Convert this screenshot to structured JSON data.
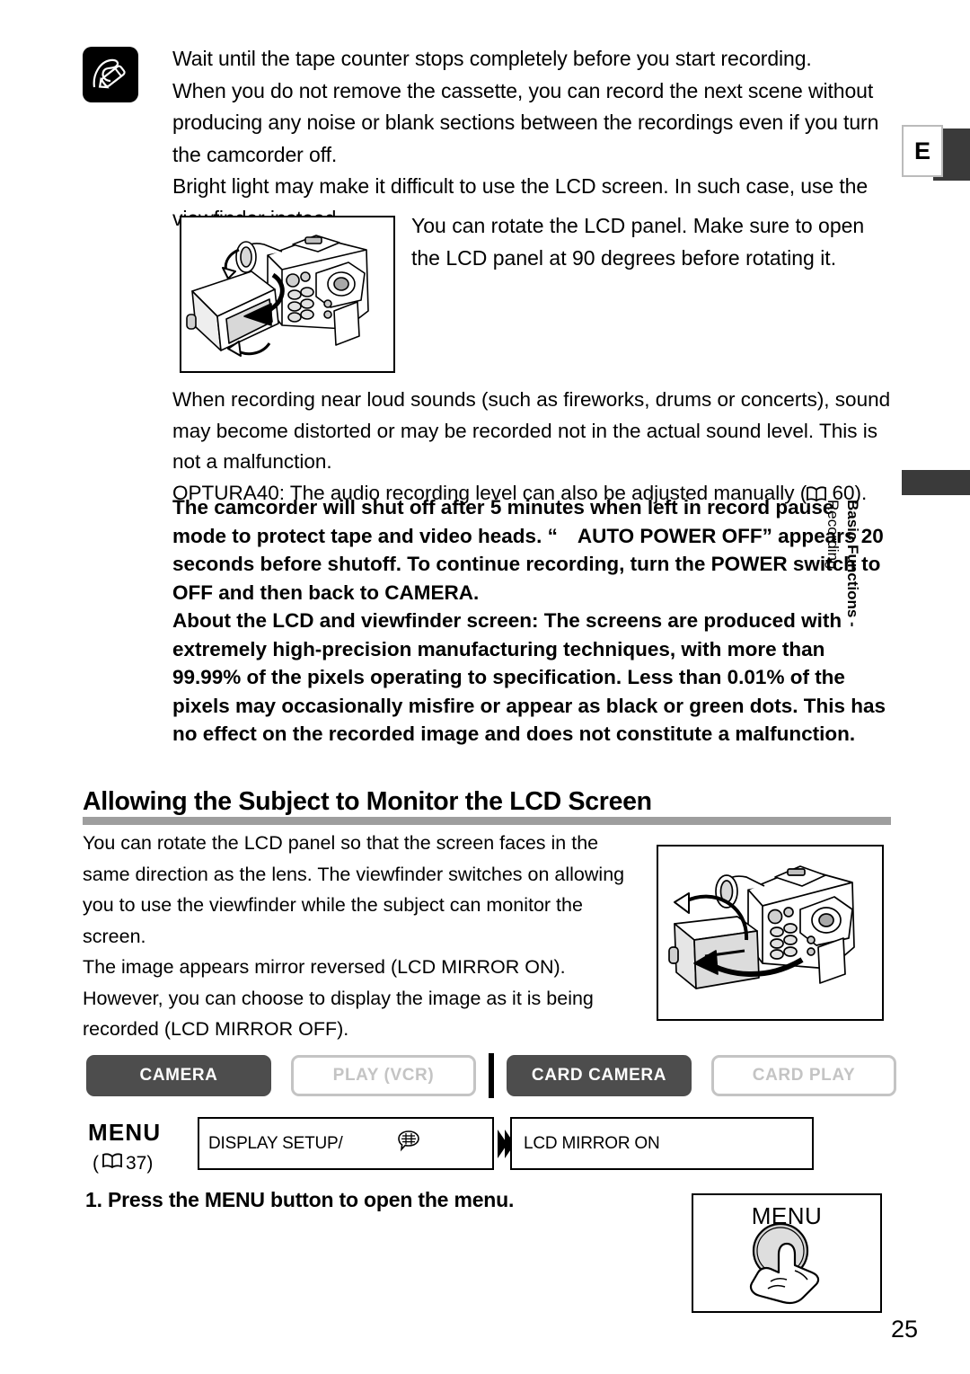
{
  "sidebar": {
    "language_tab": "E",
    "chapter_bold": "Basic Functions -",
    "chapter_regular": "Recording"
  },
  "notes": {
    "icon": "note-pencil-icon",
    "lines": [
      "Wait until the tape counter stops completely before you start recording.",
      "When you do not remove the cassette, you can record the next scene without producing any noise or blank sections between the recordings even if you turn the camcorder off.",
      "Bright light may make it difficult to use the LCD screen. In such case, use the viewfinder instead."
    ],
    "rotate_note": "You can rotate the LCD panel. Make sure to open the LCD panel at 90 degrees before rotating it."
  },
  "mid": {
    "loud_sounds": "When recording near loud sounds (such as fireworks, drums or concerts), sound may become distorted or may be recorded not in the actual sound level. This is not a malfunction.",
    "optura_prefix": "OPTURA40: The audio recording level can also be adjusted manually (",
    "optura_page": "60).",
    "book_icon": "book-icon"
  },
  "bold_block": {
    "para1_a": "The camcorder will shut off after 5 minutes when left in record pause mode to protect tape and video heads. “",
    "para1_b": "AUTO POWER OFF” appears 20 seconds before shutoff. To continue recording, turn the POWER switch to OFF and then back to CAMERA.",
    "para2": "About the LCD and viewfinder screen: The screens are produced with extremely high-precision manufacturing techniques, with more than 99.99% of the pixels operating to specification. Less than 0.01% of the pixels may occasionally misfire or appear as black or green dots. This has no effect on the recorded image and does not constitute a malfunction."
  },
  "section": {
    "heading": "Allowing the Subject to Monitor the LCD Screen",
    "body": [
      "You can rotate the LCD panel so that the screen faces in the same direction as the lens. The viewfinder switches on allowing you to use the viewfinder while the subject can monitor the screen.",
      "The image appears mirror reversed (LCD MIRROR ON).",
      "However, you can choose to display the image as it is being recorded (LCD MIRROR OFF)."
    ]
  },
  "modes": [
    {
      "label": "CAMERA",
      "state": "on"
    },
    {
      "label": "PLAY (VCR)",
      "state": "off"
    },
    {
      "label": "CARD CAMERA",
      "state": "on"
    },
    {
      "label": "CARD PLAY",
      "state": "off"
    }
  ],
  "menu_row": {
    "menu_label": "MENU",
    "ref_open": "(",
    "ref_page": "37)",
    "box1_label": "DISPLAY SETUP/",
    "box1_icon": "speech-bubble-display-icon",
    "arrow_icon": "double-chevron-right-icon",
    "box2_label": "LCD MIRROR  ON"
  },
  "step": {
    "text": "1. Press the MENU button to open the menu.",
    "figure_label": "MENU"
  },
  "figures": {
    "fig1_name": "camcorder-lcd-rotate-illustration",
    "fig2_name": "camcorder-lcd-mirror-illustration",
    "fig3_name": "menu-button-press-illustration"
  },
  "page_number": "25",
  "colors": {
    "mode_on_bg": "#4d4d4d",
    "mode_off_border": "#c4c4c4",
    "rule_gray": "#9e9e9e",
    "tab_dark": "#3a3a3a"
  }
}
